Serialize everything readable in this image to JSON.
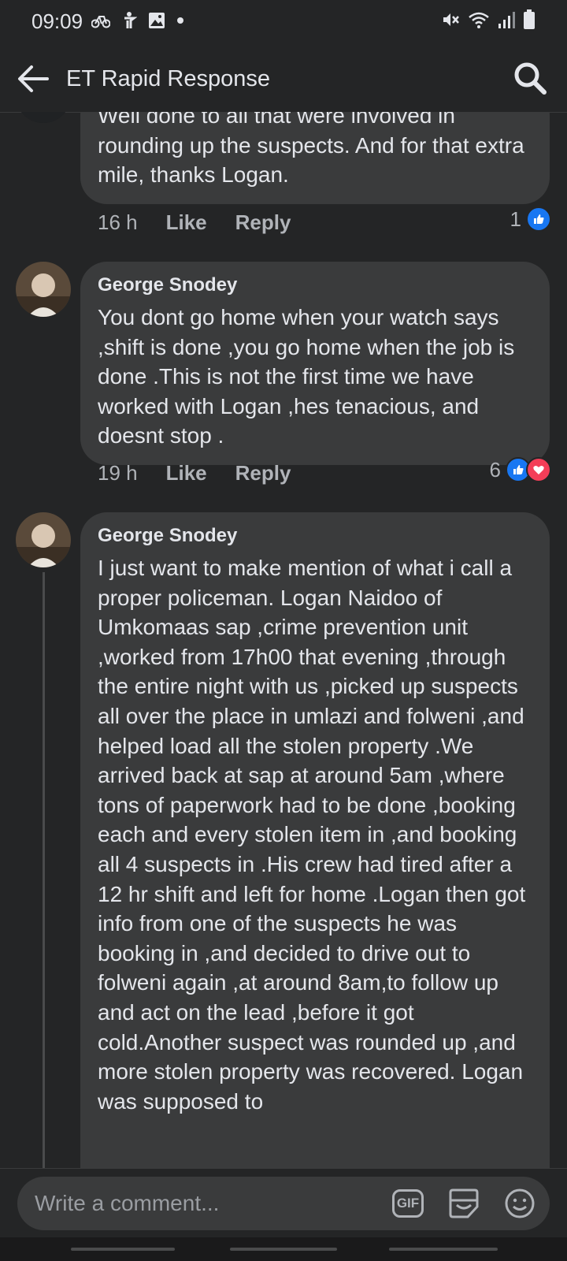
{
  "status": {
    "time": "09:09",
    "icons": [
      "bike-notification-icon",
      "accessibility-icon",
      "image-notification-icon",
      "dot-icon",
      "mute-icon",
      "wifi-icon",
      "signal-icon",
      "battery-icon"
    ]
  },
  "header": {
    "title": "ET Rapid Response",
    "back_icon": "arrow-left-icon",
    "search_icon": "search-icon"
  },
  "comments": [
    {
      "author": "",
      "text": "Well done to all that were involved in rounding up the suspects. And for that extra mile, thanks Logan.",
      "time": "16 h",
      "like_label": "Like",
      "reply_label": "Reply",
      "reaction_count": "1",
      "reactions": [
        "like"
      ]
    },
    {
      "author": "George Snodey",
      "text": "You dont go home when your watch says ,shift is done ,you go home when the job is done .This is not the first time we have worked with Logan ,hes tenacious, and doesnt stop .",
      "time": "19 h",
      "like_label": "Like",
      "reply_label": "Reply",
      "reaction_count": "6",
      "reactions": [
        "like",
        "love"
      ]
    },
    {
      "author": "George Snodey",
      "text": "I just want to make mention of what i call a proper policeman. Logan Naidoo of Umkomaas sap ,crime prevention unit ,worked from 17h00 that evening ,through the entire night with us ,picked up suspects all over the place in umlazi and folweni ,and helped load all the stolen property .We arrived back at sap at around 5am ,where tons of paperwork had to be done ,booking each and every stolen item in ,and booking all 4 suspects in .His crew had tired after a 12 hr shift and left for home .Logan then got info from one of the suspects he was booking in ,and decided to drive out to folweni again ,at around 8am,to follow up and act on the lead ,before it got cold.Another suspect was rounded up ,and more stolen property was recovered. Logan was supposed to"
    }
  ],
  "composer": {
    "placeholder": "Write a comment...",
    "gif_label": "GIF",
    "sticker_icon": "sticker-icon",
    "emoji_icon": "emoji-icon"
  },
  "colors": {
    "background": "#242526",
    "bubble": "#3a3b3c",
    "like_blue": "#1877f2",
    "love_red": "#f33e58"
  }
}
